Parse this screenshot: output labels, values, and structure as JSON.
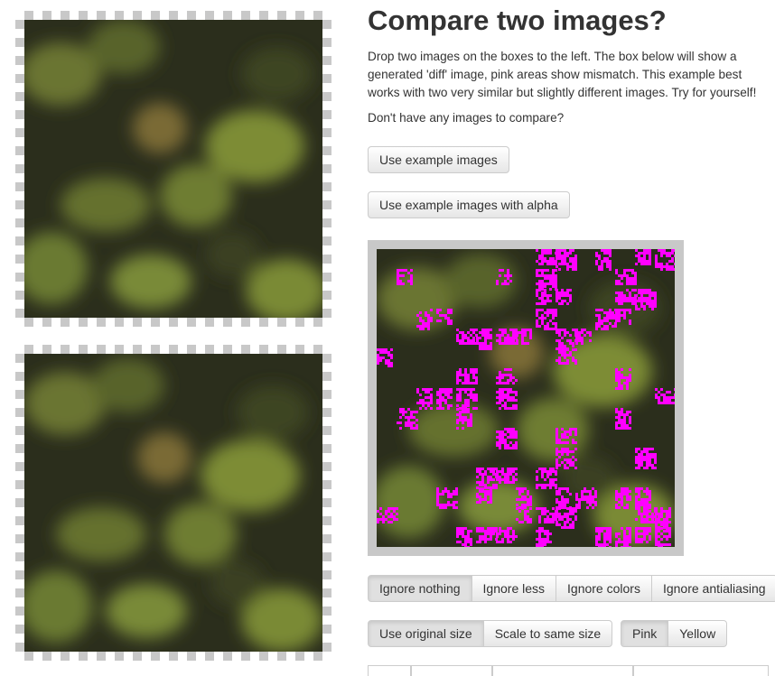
{
  "heading": "Compare two images?",
  "description": "Drop two images on the boxes to the left. The box below will show a generated 'diff' image, pink areas show mismatch. This example best works with two very similar but slightly different images. Try for yourself!",
  "no_images_text": "Don't have any images to compare?",
  "buttons": {
    "example": "Use example images",
    "example_alpha": "Use example images with alpha"
  },
  "ignore_options": [
    {
      "label": "Ignore nothing",
      "active": true
    },
    {
      "label": "Ignore less",
      "active": false
    },
    {
      "label": "Ignore colors",
      "active": false
    },
    {
      "label": "Ignore antialiasing",
      "active": false
    }
  ],
  "size_options": [
    {
      "label": "Use original size",
      "active": true
    },
    {
      "label": "Scale to same size",
      "active": false
    }
  ],
  "color_options": [
    {
      "label": "Pink",
      "active": true
    },
    {
      "label": "Yellow",
      "active": false
    }
  ],
  "colors": {
    "mismatch": "#ff00ff",
    "foliage_dark": "#2c2f1c",
    "foliage_light": "#8a9a3a"
  }
}
